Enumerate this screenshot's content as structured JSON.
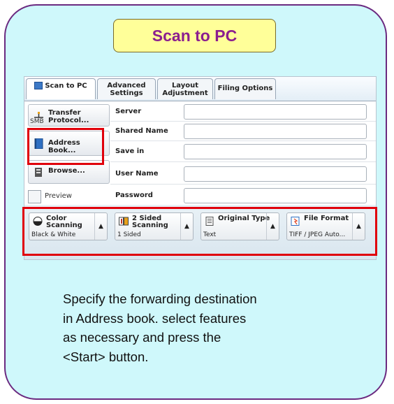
{
  "title": "Scan to PC",
  "tabs": [
    {
      "label": "Scan to PC"
    },
    {
      "label_line1": "Advanced",
      "label_line2": "Settings"
    },
    {
      "label_line1": "Layout",
      "label_line2": "Adjustment"
    },
    {
      "label": "Filing Options"
    }
  ],
  "left_buttons": {
    "transfer_line1": "Transfer",
    "transfer_line2": "Protocol...",
    "transfer_value": "SMB",
    "address_book": "Address Book...",
    "browse": "Browse..."
  },
  "preview_label": "Preview",
  "fields": {
    "server": "Server",
    "shared_name": "Shared Name",
    "save_in": "Save in",
    "user_name": "User Name",
    "password": "Password"
  },
  "features": [
    {
      "title_line1": "Color",
      "title_line2": "Scanning",
      "value": "Black & White",
      "icon": "color-mode-icon"
    },
    {
      "title_line1": "2 Sided",
      "title_line2": "Scanning",
      "value": "1 Sided",
      "icon": "two-sided-icon"
    },
    {
      "title_line1": "Original Type",
      "title_line2": "",
      "value": "Text",
      "icon": "document-icon"
    },
    {
      "title_line1": "File Format",
      "title_line2": "",
      "value": "TIFF / JPEG Auto...",
      "icon": "file-format-icon"
    }
  ],
  "instructions": [
    "Specify the forwarding destination",
    "in Address book. select features",
    "as necessary and press the",
    "<Start> button."
  ],
  "colors": {
    "card_bg": "#cff8fb",
    "card_border": "#6b2a80",
    "title_bg": "#ffff99",
    "title_text": "#8b1f8f",
    "highlight": "#e0000b"
  }
}
